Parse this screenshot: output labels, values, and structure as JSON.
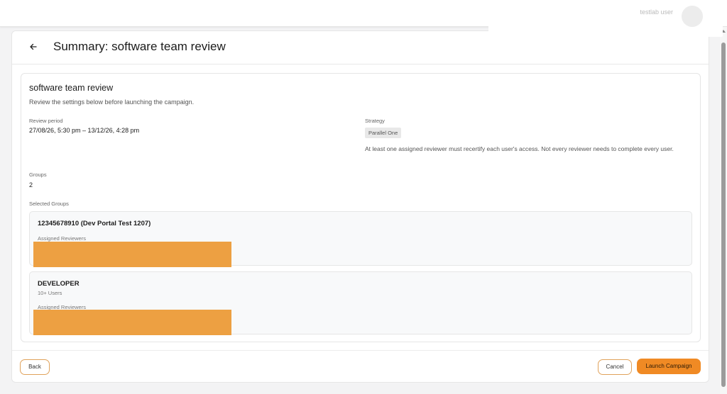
{
  "header": {
    "title": "Summary: software team review",
    "user_name": "testlab user"
  },
  "panel": {
    "title": "software team review",
    "subtitle": "Review the settings below before launching the campaign.",
    "review_period_label": "Review period",
    "review_period_value": "27/08/26, 5:30 pm – 13/12/26, 4:28 pm",
    "strategy_label": "Strategy",
    "strategy_value": "Parallel One",
    "strategy_description": "At least one assigned reviewer must recertify each user's access. Not every reviewer needs to complete every user.",
    "groups_label": "Groups",
    "groups_value": "2",
    "selected_groups_label": "Selected Groups",
    "groups": [
      {
        "name": "12345678910 (Dev Portal Test 1207)",
        "users": "",
        "reviewers_label": "Assigned Reviewers"
      },
      {
        "name": "DEVELOPER",
        "users": "10+ Users",
        "reviewers_label": "Assigned Reviewers"
      }
    ]
  },
  "footer": {
    "back_label": "Back",
    "cancel_label": "Cancel",
    "launch_label": "Launch Campaign"
  },
  "colors": {
    "accent": "#f08a24",
    "redaction": "#eda042",
    "outline": "#e0a25b"
  },
  "icons": {
    "back": "arrow-left-icon"
  }
}
